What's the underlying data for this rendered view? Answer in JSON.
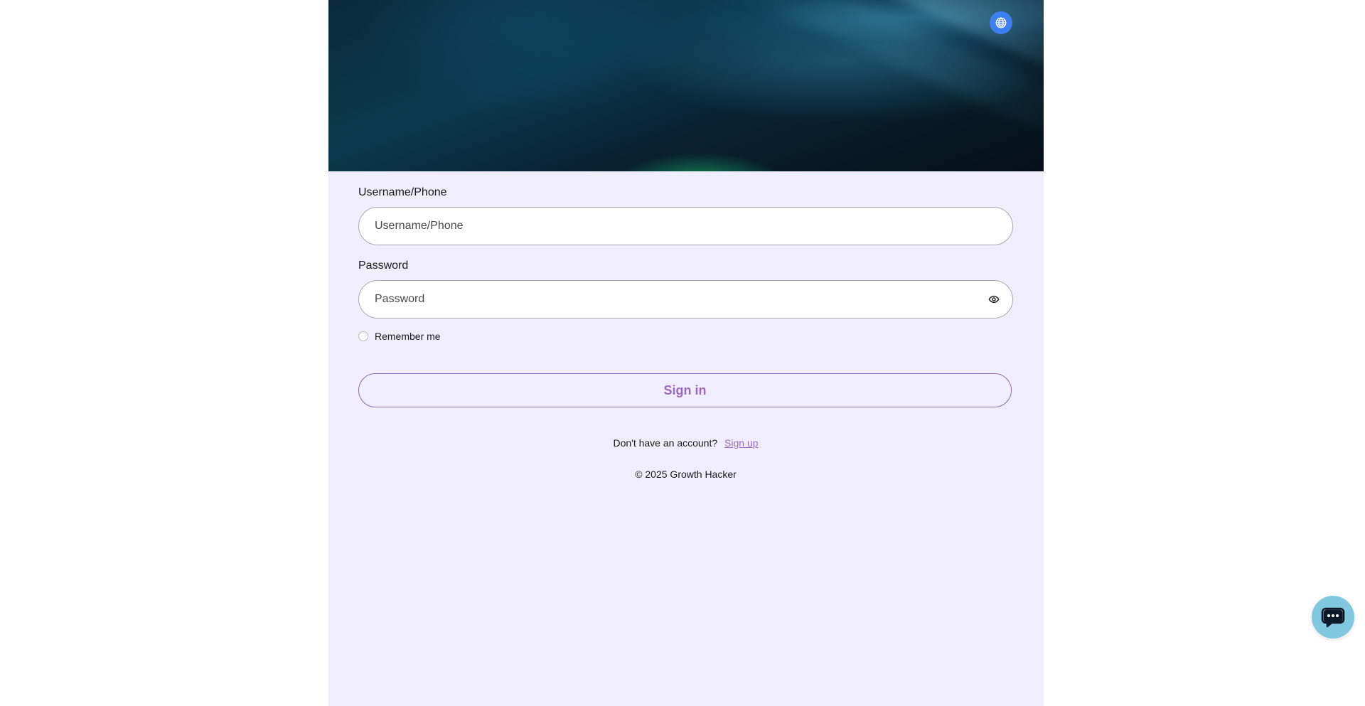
{
  "login": {
    "username_label": "Username/Phone",
    "username_placeholder": "Username/Phone",
    "password_label": "Password",
    "password_placeholder": "Password",
    "remember_label": "Remember me",
    "signin_label": "Sign in",
    "no_account_text": "Don't have an account?",
    "signup_link": "Sign up",
    "copyright": "© 2025 Growth Hacker"
  },
  "icons": {
    "language": "globe-icon",
    "password_toggle": "eye-icon",
    "chat": "chat-bubble-icon"
  },
  "colors": {
    "panel_background": "#f0eefc",
    "accent": "#9a6ac0",
    "language_button": "#3d7ef0",
    "chat_button": "#7fc8e0"
  }
}
